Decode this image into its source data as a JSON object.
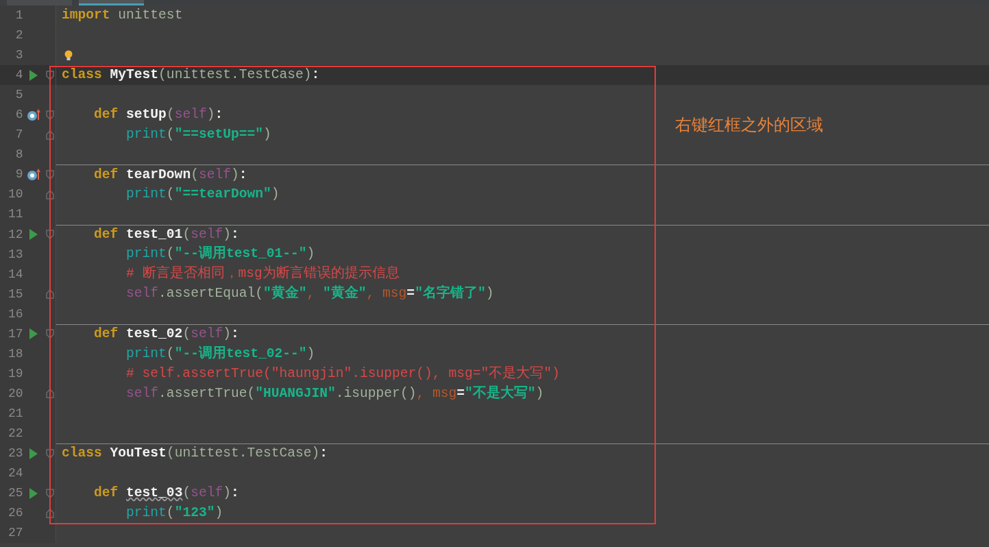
{
  "editor_tabs": [
    {
      "selected": false
    },
    {
      "selected": true
    }
  ],
  "lines": [
    {
      "number": "1",
      "tokens": [
        {
          "text": "import",
          "kind": "kw"
        },
        {
          "text": " unittest",
          "kind": "plain"
        }
      ]
    },
    {
      "number": "2"
    },
    {
      "number": "3",
      "bulb": true
    },
    {
      "number": "4",
      "current": true,
      "run_button": true,
      "fold_start": true,
      "tokens": [
        {
          "text": "class",
          "kind": "kw"
        },
        {
          "text": " MyTest",
          "kind": "name"
        },
        {
          "text": "(unittest.TestCase)",
          "kind": "plain"
        },
        {
          "text": ":",
          "kind": "name"
        }
      ],
      "children": [
        {
          "number": "5"
        },
        {
          "number": "6",
          "override_marker": true,
          "fold_start": true,
          "tokens": [
            {
              "text": "def",
              "kind": "kw"
            },
            {
              "text": " setUp",
              "kind": "name"
            },
            {
              "text": "(",
              "kind": "plain"
            },
            {
              "text": "self",
              "kind": "self"
            },
            {
              "text": ")",
              "kind": "plain"
            },
            {
              "text": ":",
              "kind": "name"
            }
          ],
          "children": [
            {
              "number": "7",
              "fold_end": true,
              "tokens": [
                {
                  "text": "print",
                  "kind": "builtin"
                },
                {
                  "text": "(",
                  "kind": "plain"
                },
                {
                  "text": "\"==setUp==\"",
                  "kind": "str"
                },
                {
                  "text": ")",
                  "kind": "plain"
                }
              ]
            }
          ]
        },
        {
          "number": "8"
        },
        {
          "number": "9",
          "separator": true,
          "override_marker": true,
          "fold_start": true,
          "tokens": [
            {
              "text": "def",
              "kind": "kw"
            },
            {
              "text": " tearDown",
              "kind": "name"
            },
            {
              "text": "(",
              "kind": "plain"
            },
            {
              "text": "self",
              "kind": "self"
            },
            {
              "text": ")",
              "kind": "plain"
            },
            {
              "text": ":",
              "kind": "name"
            }
          ],
          "children": [
            {
              "number": "10",
              "fold_end": true,
              "tokens": [
                {
                  "text": "print",
                  "kind": "builtin"
                },
                {
                  "text": "(",
                  "kind": "plain"
                },
                {
                  "text": "\"==tearDown\"",
                  "kind": "str"
                },
                {
                  "text": ")",
                  "kind": "plain"
                }
              ]
            }
          ]
        },
        {
          "number": "11"
        },
        {
          "number": "12",
          "separator": true,
          "run_button": true,
          "fold_start": true,
          "tokens": [
            {
              "text": "def",
              "kind": "kw"
            },
            {
              "text": " test_01",
              "kind": "name"
            },
            {
              "text": "(",
              "kind": "plain"
            },
            {
              "text": "self",
              "kind": "self"
            },
            {
              "text": ")",
              "kind": "plain"
            },
            {
              "text": ":",
              "kind": "name"
            }
          ],
          "children": [
            {
              "number": "13",
              "tokens": [
                {
                  "text": "print",
                  "kind": "builtin"
                },
                {
                  "text": "(",
                  "kind": "plain"
                },
                {
                  "text": "\"--调用test_01--\"",
                  "kind": "str"
                },
                {
                  "text": ")",
                  "kind": "plain"
                }
              ]
            },
            {
              "number": "14",
              "tokens": [
                {
                  "text": "# 断言是否相同，msg为断言错误的提示信息",
                  "kind": "comment"
                }
              ]
            },
            {
              "number": "15",
              "fold_end": true,
              "tokens": [
                {
                  "text": "self",
                  "kind": "self"
                },
                {
                  "text": ".assertEqual(",
                  "kind": "plain"
                },
                {
                  "text": "\"黄金\"",
                  "kind": "str"
                },
                {
                  "text": ", ",
                  "kind": "param"
                },
                {
                  "text": "\"黄金\"",
                  "kind": "str"
                },
                {
                  "text": ", msg",
                  "kind": "param"
                },
                {
                  "text": "=",
                  "kind": "name"
                },
                {
                  "text": "\"名字错了\"",
                  "kind": "str"
                },
                {
                  "text": ")",
                  "kind": "plain"
                }
              ]
            }
          ]
        },
        {
          "number": "16"
        },
        {
          "number": "17",
          "separator": true,
          "run_button": true,
          "fold_start": true,
          "tokens": [
            {
              "text": "def",
              "kind": "kw"
            },
            {
              "text": " test_02",
              "kind": "name"
            },
            {
              "text": "(",
              "kind": "plain"
            },
            {
              "text": "self",
              "kind": "self"
            },
            {
              "text": ")",
              "kind": "plain"
            },
            {
              "text": ":",
              "kind": "name"
            }
          ],
          "children": [
            {
              "number": "18",
              "tokens": [
                {
                  "text": "print",
                  "kind": "builtin"
                },
                {
                  "text": "(",
                  "kind": "plain"
                },
                {
                  "text": "\"--调用test_02--\"",
                  "kind": "str"
                },
                {
                  "text": ")",
                  "kind": "plain"
                }
              ]
            },
            {
              "number": "19",
              "tokens": [
                {
                  "text": "# self.assertTrue(\"haungjin\".isupper(), msg=\"不是大写\")",
                  "kind": "comment"
                }
              ]
            },
            {
              "number": "20",
              "fold_end": true,
              "tokens": [
                {
                  "text": "self",
                  "kind": "self"
                },
                {
                  "text": ".assertTrue(",
                  "kind": "plain"
                },
                {
                  "text": "\"HUANGJIN\"",
                  "kind": "str"
                },
                {
                  "text": ".isupper()",
                  "kind": "plain"
                },
                {
                  "text": ", msg",
                  "kind": "param"
                },
                {
                  "text": "=",
                  "kind": "name"
                },
                {
                  "text": "\"不是大写\"",
                  "kind": "str"
                },
                {
                  "text": ")",
                  "kind": "plain"
                }
              ]
            }
          ]
        },
        {
          "number": "21"
        },
        {
          "number": "22"
        }
      ]
    },
    {
      "number": "23",
      "separator": true,
      "run_button": true,
      "fold_start": true,
      "tokens": [
        {
          "text": "class",
          "kind": "kw"
        },
        {
          "text": " YouTest",
          "kind": "name"
        },
        {
          "text": "(unittest.TestCase)",
          "kind": "plain"
        },
        {
          "text": ":",
          "kind": "name"
        }
      ],
      "children": [
        {
          "number": "24"
        },
        {
          "number": "25",
          "run_button": true,
          "fold_start": true,
          "tokens": [
            {
              "text": "def ",
              "kind": "kw"
            },
            {
              "text": "test_03",
              "kind": "name",
              "underlined": true
            },
            {
              "text": "(",
              "kind": "plain"
            },
            {
              "text": "self",
              "kind": "self"
            },
            {
              "text": ")",
              "kind": "plain"
            },
            {
              "text": ":",
              "kind": "name"
            }
          ],
          "children": [
            {
              "number": "26",
              "fold_end": true,
              "tokens": [
                {
                  "text": "print",
                  "kind": "builtin"
                },
                {
                  "text": "(",
                  "kind": "plain"
                },
                {
                  "text": "\"123\"",
                  "kind": "str"
                },
                {
                  "text": ")",
                  "kind": "plain"
                }
              ]
            }
          ]
        }
      ]
    },
    {
      "number": "27"
    }
  ],
  "annotation": "右键红框之外的区域"
}
